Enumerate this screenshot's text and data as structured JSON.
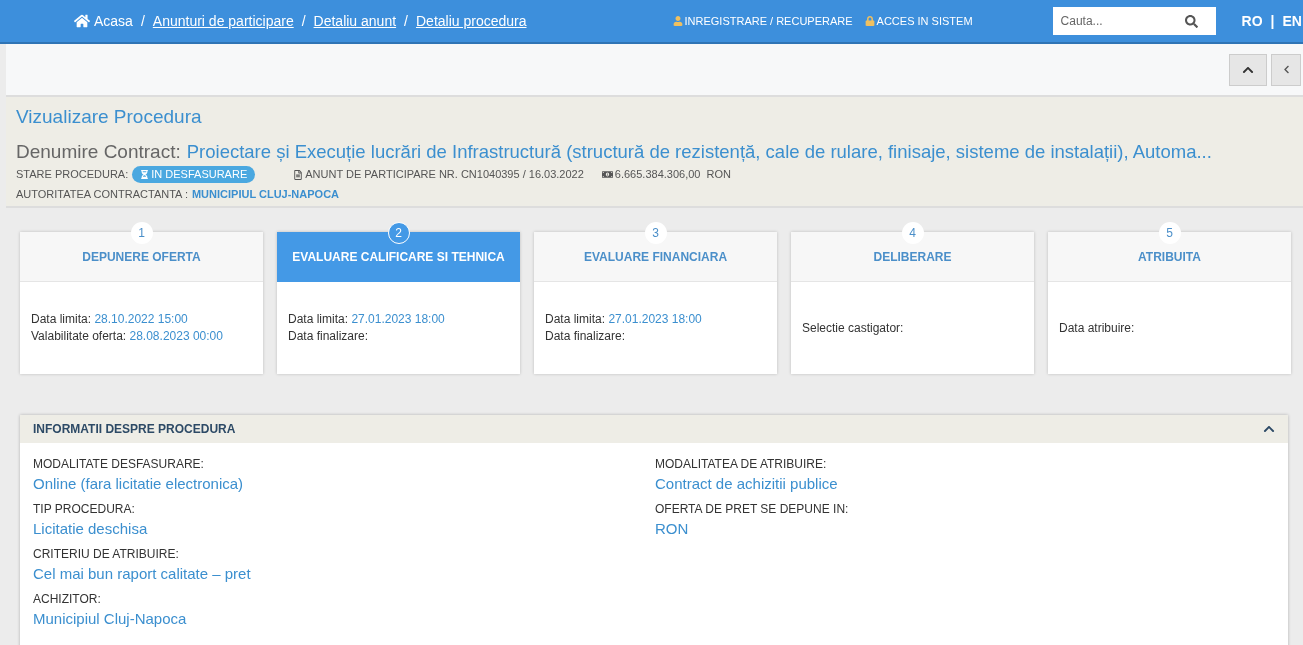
{
  "breadcrumbs": [
    {
      "label": "Acasa",
      "kind": "home"
    },
    {
      "label": "Anunturi de participare",
      "kind": "link"
    },
    {
      "label": "Detaliu anunt",
      "kind": "link"
    },
    {
      "label": "Detaliu procedura",
      "kind": "link"
    }
  ],
  "breadcrumb_separator": "/",
  "language_separator": "|",
  "top_links": [
    "INREGISTRARE / RECUPERARE",
    "ACCES IN SISTEM"
  ],
  "search": {
    "placeholder": "Cauta..."
  },
  "languages": [
    "RO",
    "EN"
  ],
  "page_title": "Vizualizare Procedura",
  "contract": {
    "label": "Denumire Contract:",
    "name": "Proiectare și Execuție lucrări de Infrastructură (structură de rezistență, cale de rulare, finisaje, sisteme de instalații), Automa..."
  },
  "status": {
    "label": "STARE PROCEDURA:",
    "badge": "IN DESFASURARE"
  },
  "notice": "ANUNT DE PARTICIPARE NR. CN1040395 / 16.03.2022",
  "value": {
    "amount": "6.665.384.306,00",
    "currency": "RON"
  },
  "authority": {
    "label": "AUTORITATEA CONTRACTANTA :",
    "name": "MUNICIPIUL CLUJ-NAPOCA"
  },
  "steps": [
    {
      "number": "1",
      "title": "DEPUNERE OFERTA",
      "selected": false,
      "fields": [
        {
          "label": "Data limita:",
          "value": "28.10.2022 15:00"
        },
        {
          "label": "Valabilitate oferta:",
          "value": "28.08.2023 00:00"
        }
      ]
    },
    {
      "number": "2",
      "title": "EVALUARE CALIFICARE SI TEHNICA",
      "selected": true,
      "fields": [
        {
          "label": "Data limita:",
          "value": "27.01.2023 18:00"
        },
        {
          "label": "Data finalizare:"
        }
      ]
    },
    {
      "number": "3",
      "title": "EVALUARE FINANCIARA",
      "selected": false,
      "fields": [
        {
          "label": "Data limita:",
          "value": "27.01.2023 18:00"
        },
        {
          "label": "Data finalizare:"
        }
      ]
    },
    {
      "number": "4",
      "title": "DELIBERARE",
      "selected": false,
      "fields": [
        {
          "label": "Selectie castigator:"
        }
      ]
    },
    {
      "number": "5",
      "title": "ATRIBUITA",
      "selected": false,
      "fields": [
        {
          "label": "Data atribuire:"
        }
      ]
    }
  ],
  "info_panel": {
    "title": "INFORMATII DESPRE PROCEDURA",
    "expanded": true,
    "left": [
      {
        "label": "MODALITATE DESFASURARE:",
        "value": "Online (fara licitatie electronica)"
      },
      {
        "label": "TIP PROCEDURA:",
        "value": "Licitatie deschisa"
      },
      {
        "label": "CRITERIU DE ATRIBUIRE:",
        "value": "Cel mai bun raport calitate – pret"
      },
      {
        "label": "ACHIZITOR:",
        "value": "Municipiul Cluj-Napoca"
      }
    ],
    "right": [
      {
        "label": "MODALITATEA DE ATRIBUIRE:",
        "value": "Contract de achizitii publice"
      },
      {
        "label": "OFERTA DE PRET SE DEPUNE IN:",
        "value": "RON"
      }
    ]
  }
}
